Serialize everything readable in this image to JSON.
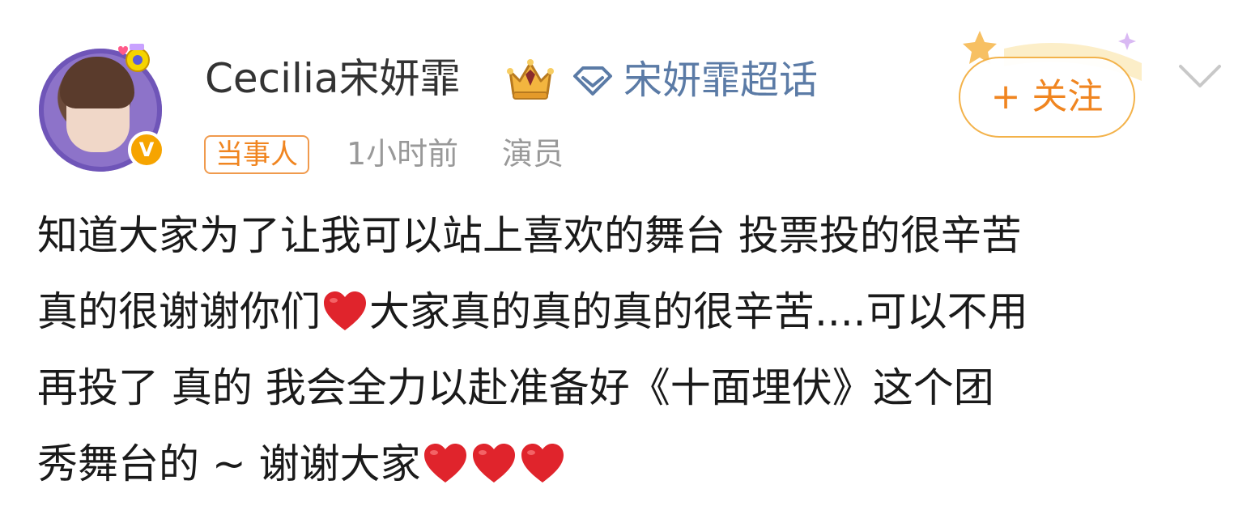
{
  "post": {
    "username": "Cecilia宋妍霏",
    "topic_label": "宋妍霏超话",
    "follow_label": "+ 关注",
    "party_tag": "当事人",
    "time": "1小时前",
    "source": "演员",
    "verified_badge": "V",
    "content_lines": [
      [
        "知道大家为了让我可以站上喜欢的舞台 投票投的很辛苦"
      ],
      [
        "真的很谢谢你们",
        "大家真的真的真的很辛苦....可以不用"
      ],
      [
        "再投了 真的  我会全力以赴准备好《十面埋伏》这个团"
      ],
      [
        "秀舞台的 ~ 谢谢大家"
      ]
    ]
  },
  "icons": {
    "crown": "crown-badge-icon",
    "topic": "diamond-topic-icon",
    "heart": "red-heart-icon",
    "chevron": "chevron-down-icon"
  },
  "colors": {
    "username": "#333333",
    "topic_link": "#5b7ba6",
    "follow_accent": "#f08520",
    "meta_gray": "#999999",
    "heart_red": "#e0242c"
  }
}
